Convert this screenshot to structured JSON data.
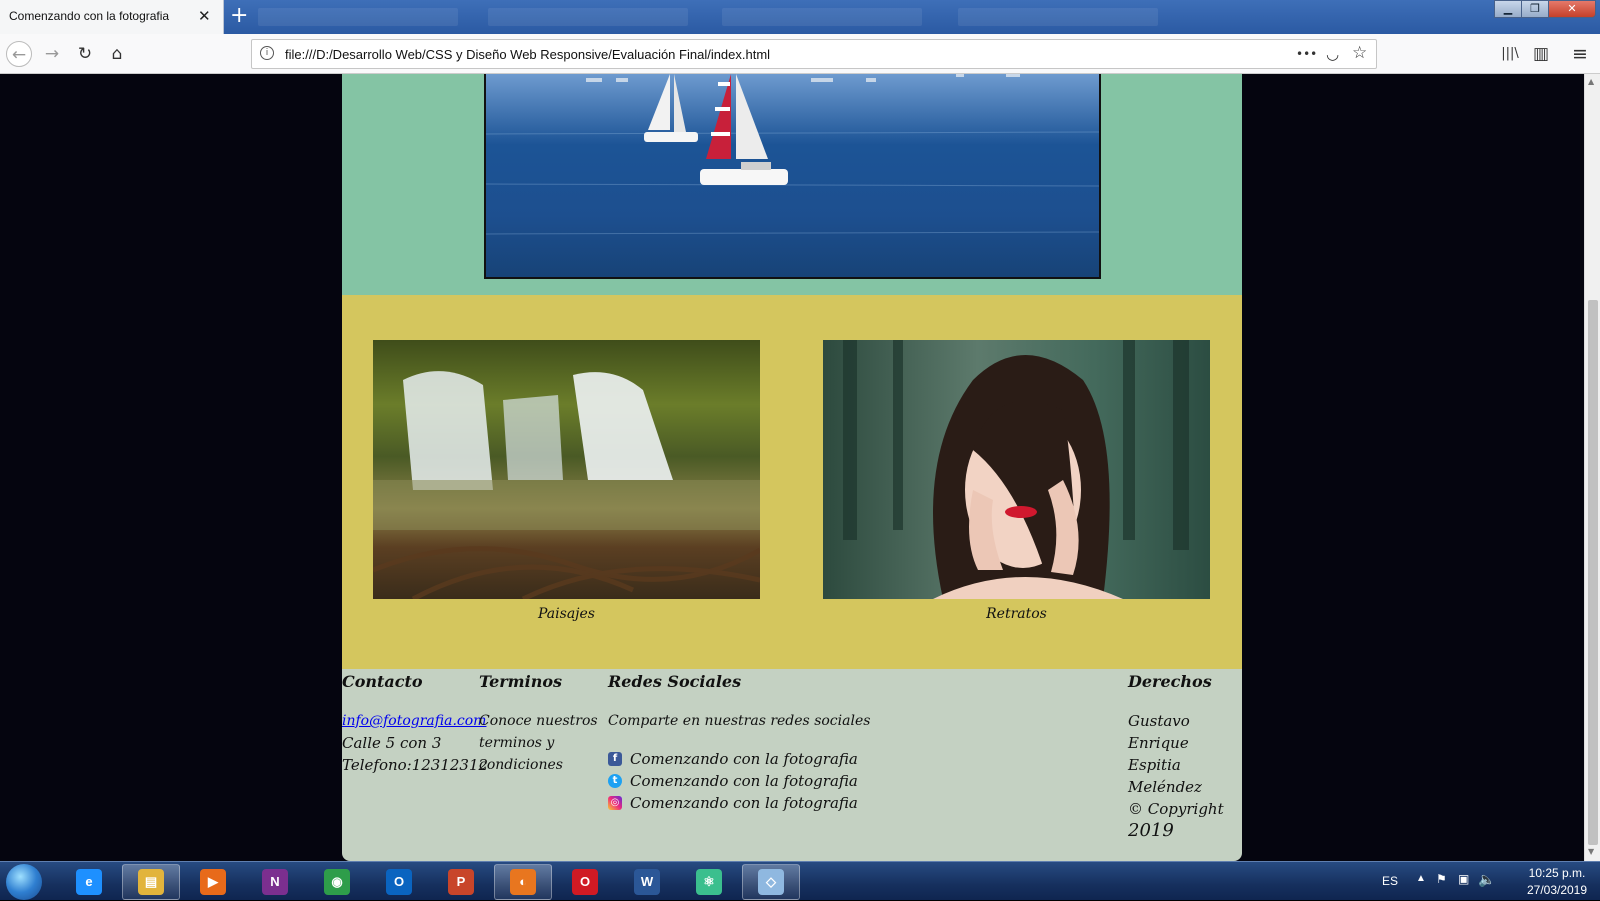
{
  "browser": {
    "tab_title": "Comenzando con la fotografia",
    "tab_close": "✕",
    "new_tab": "+",
    "url": "file:///D:/Desarrollo Web/CSS y Diseño Web Responsive/Evaluación Final/index.html",
    "window_buttons": {
      "minimize": "▁",
      "maximize": "❐",
      "close": "✕"
    },
    "nav_icons": {
      "back": "←",
      "forward": "→",
      "reload": "↻",
      "home": "⌂"
    },
    "url_icons": {
      "info": "i",
      "more": "•••",
      "pocket": "◡",
      "star": "☆"
    },
    "toolbar_icons": {
      "library": "|||\\",
      "sidebar": "▥",
      "menu": "≡"
    }
  },
  "page": {
    "gallery": [
      {
        "caption": "Paisajes",
        "image": "waterfall-photo"
      },
      {
        "caption": "Retratos",
        "image": "portrait-photo"
      }
    ],
    "footer": {
      "contact": {
        "heading": "Contacto",
        "email": "info@fotografia.com",
        "address": "Calle 5 con 3",
        "phone": "Telefono:12312312"
      },
      "terms": {
        "heading": "Terminos",
        "text": "Conoce nuestros terminos y condiciones"
      },
      "social": {
        "heading": "Redes Sociales",
        "intro": "Comparte en nuestras redes sociales",
        "items": [
          {
            "icon": "facebook-icon",
            "glyph": "f",
            "color": "#3b5998",
            "label": "Comenzando con la fotografia"
          },
          {
            "icon": "twitter-icon",
            "glyph": "t",
            "color": "#1da1f2",
            "label": "Comenzando con la fotografia"
          },
          {
            "icon": "instagram-icon",
            "glyph": "◎",
            "color": "#d6249f",
            "label": "Comenzando con la fotografia"
          }
        ]
      },
      "rights": {
        "heading": "Derechos",
        "line1": "Gustavo Enrique",
        "line2": "Espitia",
        "line3": "Meléndez",
        "line4": "© Copyright",
        "year": "2019"
      }
    },
    "colors": {
      "hero_bg": "#84c4a4",
      "gallery_bg": "#d4c65e",
      "footer_bg": "#c4d1c2",
      "page_bg": "#05050f",
      "link": "#0000ee"
    }
  },
  "taskbar": {
    "apps": [
      {
        "name": "internet-explorer",
        "glyph": "e",
        "color": "#1e90ff",
        "open": false
      },
      {
        "name": "file-explorer",
        "glyph": "▤",
        "color": "#e2b43c",
        "open": true
      },
      {
        "name": "media-player",
        "glyph": "▶",
        "color": "#e86a1a",
        "open": false
      },
      {
        "name": "onenote",
        "glyph": "N",
        "color": "#7b2f8f",
        "open": false
      },
      {
        "name": "chrome",
        "glyph": "◉",
        "color": "#2e9d4a",
        "open": false
      },
      {
        "name": "outlook",
        "glyph": "O",
        "color": "#0a64c0",
        "open": false
      },
      {
        "name": "powerpoint",
        "glyph": "P",
        "color": "#c8452a",
        "open": false
      },
      {
        "name": "firefox",
        "glyph": "◐",
        "color": "#e8761f",
        "open": true
      },
      {
        "name": "opera",
        "glyph": "O",
        "color": "#d01a24",
        "open": false
      },
      {
        "name": "word",
        "glyph": "W",
        "color": "#2b5797",
        "open": false
      },
      {
        "name": "atom",
        "glyph": "⚛",
        "color": "#3bbf8e",
        "open": false
      },
      {
        "name": "app-window",
        "glyph": "◇",
        "color": "#8fb8e0",
        "open": true
      }
    ],
    "tray": {
      "language": "ES",
      "time": "10:25 p.m.",
      "date": "27/03/2019"
    }
  }
}
